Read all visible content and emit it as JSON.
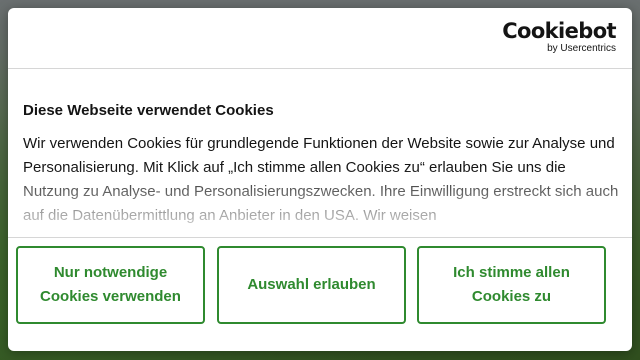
{
  "brand": {
    "name": "Cookiebot",
    "sub": "by Usercentrics"
  },
  "consent": {
    "title": "Diese Webseite verwendet Cookies",
    "text": "Wir verwenden Cookies für grundlegende Funktionen der Website sowie zur Analyse und Personalisierung. Mit Klick auf „Ich stimme allen Cookies zu“ erlauben Sie uns die Nutzung zu Analyse- und Personalisierungszwecken. Ihre Einwilligung erstreckt sich auch auf die Datenübermittlung an Anbieter in den USA. Wir weisen"
  },
  "buttons": {
    "necessary": "Nur notwendige Cookies verwenden",
    "selection": "Auswahl erlauben",
    "all": "Ich stimme allen Cookies zu"
  },
  "colors": {
    "accent": "#2f8a2f",
    "text": "#141414",
    "divider": "#d6d6d6"
  }
}
